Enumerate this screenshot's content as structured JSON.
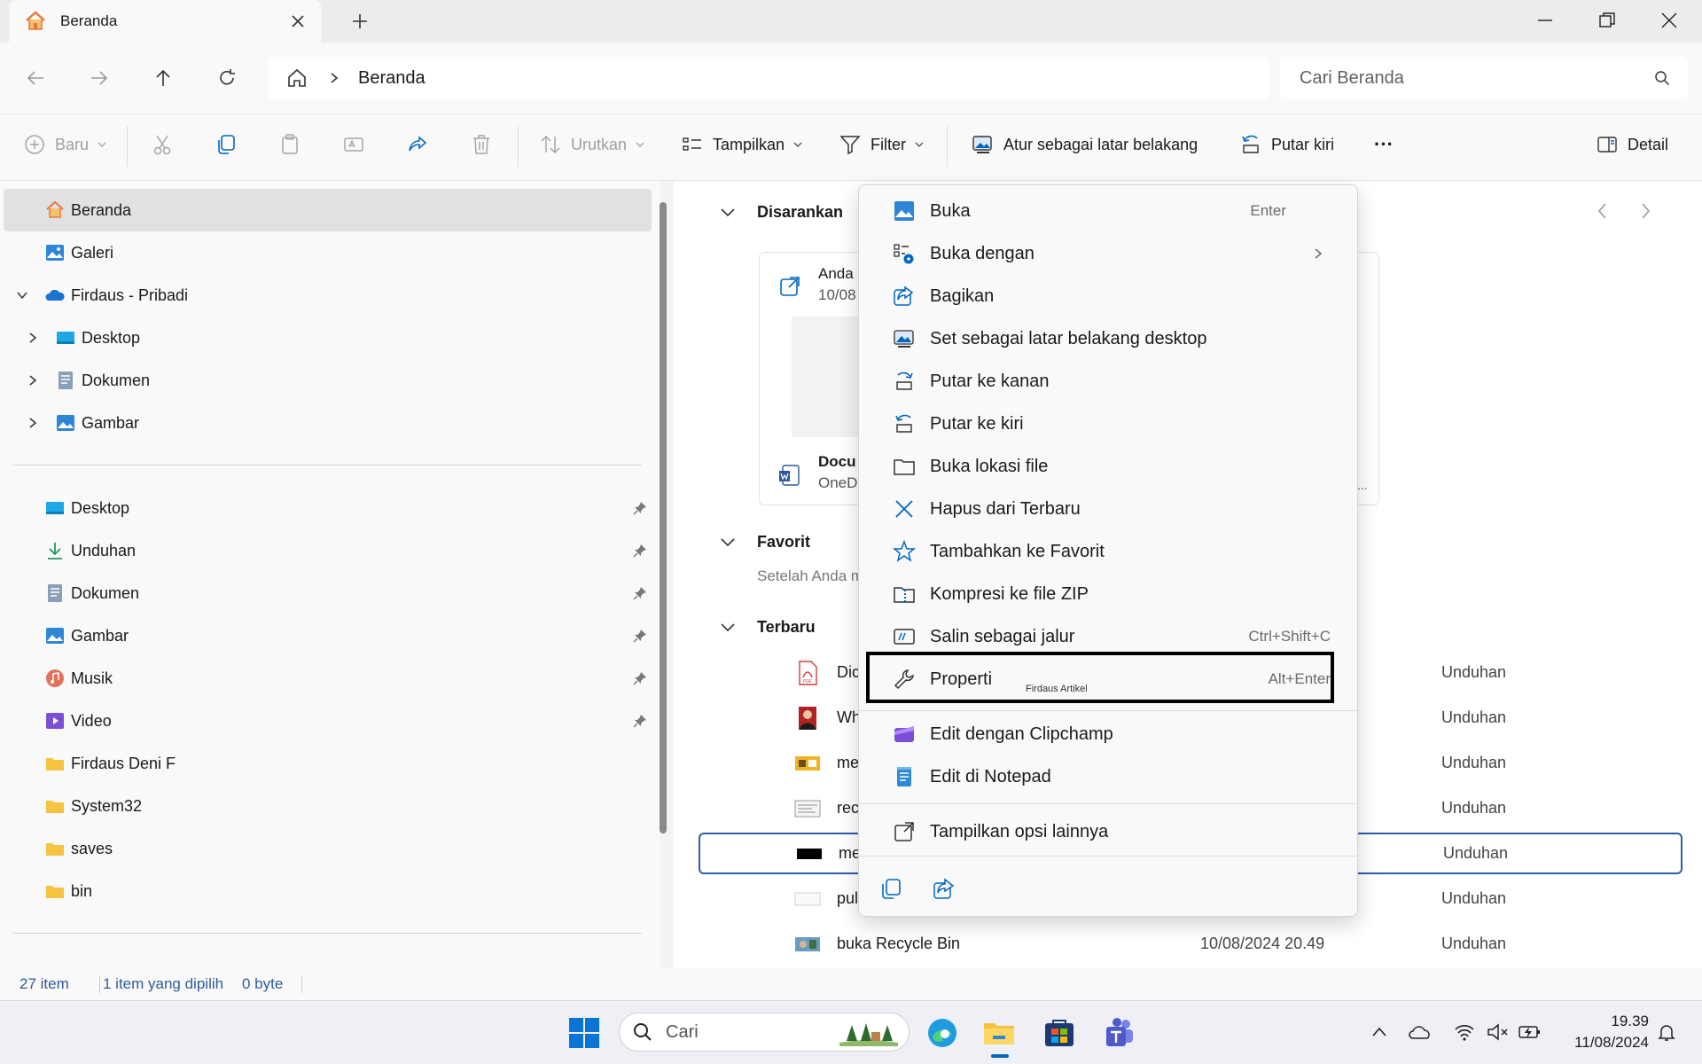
{
  "window": {
    "tab_title": "Beranda",
    "new_tab": "+"
  },
  "address": {
    "crumb": "Beranda",
    "search_placeholder": "Cari Beranda"
  },
  "toolbar": {
    "new_label": "Baru",
    "sort_label": "Urutkan",
    "view_label": "Tampilkan",
    "filter_label": "Filter",
    "set_bg_label": "Atur sebagai latar belakang",
    "rotate_label": "Putar kiri",
    "more_label": "···",
    "details_label": "Detail"
  },
  "sidebar": {
    "top_items": [
      {
        "label": "Beranda",
        "icon": "home-icon"
      },
      {
        "label": "Galeri",
        "icon": "gallery-icon"
      },
      {
        "label": "Firdaus - Pribadi",
        "icon": "onedrive-icon"
      },
      {
        "label": "Desktop",
        "icon": "desktop-folder-icon"
      },
      {
        "label": "Dokumen",
        "icon": "documents-icon"
      },
      {
        "label": "Gambar",
        "icon": "pictures-icon"
      }
    ],
    "pinned_items": [
      {
        "label": "Desktop",
        "icon": "desktop-folder-icon"
      },
      {
        "label": "Unduhan",
        "icon": "download-icon"
      },
      {
        "label": "Dokumen",
        "icon": "documents-icon"
      },
      {
        "label": "Gambar",
        "icon": "pictures-icon"
      },
      {
        "label": "Musik",
        "icon": "music-icon"
      },
      {
        "label": "Video",
        "icon": "video-icon"
      },
      {
        "label": "Firdaus Deni F",
        "icon": "folder-icon"
      },
      {
        "label": "System32",
        "icon": "folder-icon"
      },
      {
        "label": "saves",
        "icon": "folder-icon"
      },
      {
        "label": "bin",
        "icon": "folder-icon"
      }
    ]
  },
  "content": {
    "suggested_title": "Disarankan",
    "card_line1": "Anda",
    "card_line2": "10/08",
    "card_doc_title": "Docu",
    "card_doc_sub": "OneD",
    "card_dots": "...",
    "favorites_title": "Favorit",
    "favorites_hint": "Setelah Anda m",
    "recent_title": "Terbaru",
    "recent_rows": [
      {
        "name": "Dic",
        "date": "",
        "location": "Unduhan",
        "icon": "pdf-file-icon"
      },
      {
        "name": "Wh",
        "date": "",
        "location": "Unduhan",
        "icon": "photo-portrait-icon"
      },
      {
        "name": "me",
        "date": "",
        "location": "Unduhan",
        "icon": "image-file-icon"
      },
      {
        "name": "rec",
        "date": "",
        "location": "Unduhan",
        "icon": "screenshot-file-icon"
      },
      {
        "name": "me",
        "date": "",
        "location": "Unduhan",
        "icon": "black-image-icon"
      },
      {
        "name": "pul",
        "date": "",
        "location": "Unduhan",
        "icon": "blank-image-icon"
      },
      {
        "name": "buka Recycle Bin",
        "date": "10/08/2024 20.49",
        "location": "Unduhan",
        "icon": "image-file-icon"
      }
    ]
  },
  "context_menu": {
    "items": [
      {
        "label": "Buka",
        "shortcut": "Enter",
        "icon": "open-image-icon"
      },
      {
        "label": "Buka dengan",
        "shortcut": "",
        "icon": "open-with-icon",
        "submenu": true
      },
      {
        "label": "Bagikan",
        "shortcut": "",
        "icon": "share-icon"
      },
      {
        "label": "Set sebagai latar belakang desktop",
        "shortcut": "",
        "icon": "wallpaper-icon"
      },
      {
        "label": "Putar ke kanan",
        "shortcut": "",
        "icon": "rotate-right-icon"
      },
      {
        "label": "Putar ke kiri",
        "shortcut": "",
        "icon": "rotate-left-icon"
      },
      {
        "label": "Buka lokasi file",
        "shortcut": "",
        "icon": "folder-outline-icon"
      },
      {
        "label": "Hapus dari Terbaru",
        "shortcut": "",
        "icon": "close-x-icon"
      },
      {
        "label": "Tambahkan ke Favorit",
        "shortcut": "",
        "icon": "star-icon"
      },
      {
        "label": "Kompresi ke file ZIP",
        "shortcut": "",
        "icon": "zip-icon"
      },
      {
        "label": "Salin sebagai jalur",
        "shortcut": "Ctrl+Shift+C",
        "icon": "copy-path-icon"
      },
      {
        "label": "Properti",
        "shortcut": "Alt+Enter",
        "icon": "wrench-icon"
      },
      {
        "label": "Edit dengan Clipchamp",
        "shortcut": "",
        "icon": "clipchamp-icon"
      },
      {
        "label": "Edit di Notepad",
        "shortcut": "",
        "icon": "notepad-icon"
      },
      {
        "label": "Tampilkan opsi lainnya",
        "shortcut": "",
        "icon": "more-options-icon"
      }
    ],
    "watermark": "Firdaus Artikel"
  },
  "status": {
    "count": "27 item",
    "selected": "1 item yang dipilih",
    "size": "0 byte"
  },
  "taskbar": {
    "search_label": "Cari",
    "time": "19.39",
    "date": "11/08/2024"
  },
  "colors": {
    "accent": "#0067c0",
    "selection_border": "#2b5ea9",
    "highlight_box": "#000000"
  }
}
